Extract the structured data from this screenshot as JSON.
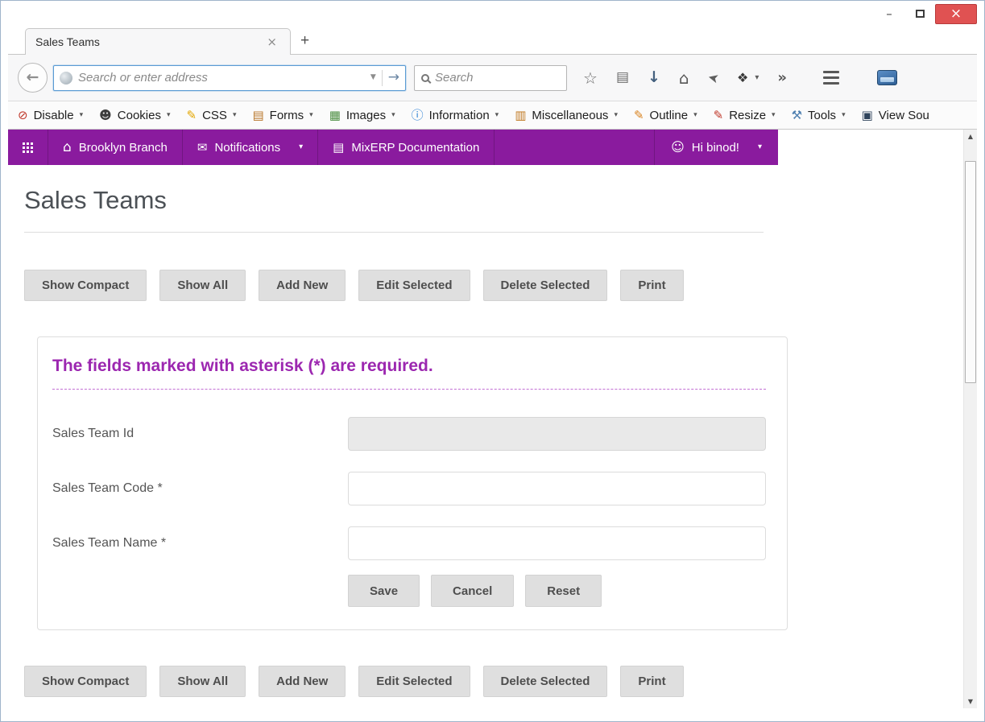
{
  "colors": {
    "brand_purple": "#8a1b9e",
    "note_purple": "#9c27b0",
    "close_red": "#e05252"
  },
  "glyphs": {
    "minimize": "–",
    "close": "×",
    "tab_close": "×",
    "new_tab": "+",
    "back": "←",
    "url_dropdown": "▼",
    "go": "→",
    "star": "☆",
    "clipboard": "▤",
    "download": "↓",
    "home": "⌂",
    "send": "➤",
    "addon": "❖",
    "caret": "▾",
    "overflow": "»",
    "house": "⌂",
    "envelope": "✉",
    "book": "▤",
    "smiley": "☺",
    "scroll_up": "▲",
    "scroll_down": "▼"
  },
  "browser": {
    "tab_title": "Sales Teams",
    "address_placeholder": "Search or enter address",
    "search_placeholder": "Search"
  },
  "devbar": {
    "items": [
      {
        "label": "Disable",
        "icon": "⊘",
        "icon_color": "#c0392b"
      },
      {
        "label": "Cookies",
        "icon": "☻",
        "icon_color": "#3d3d3d"
      },
      {
        "label": "CSS",
        "icon": "✎",
        "icon_color": "#e3a600"
      },
      {
        "label": "Forms",
        "icon": "▤",
        "icon_color": "#b8762a"
      },
      {
        "label": "Images",
        "icon": "▦",
        "icon_color": "#4e8f44"
      },
      {
        "label": "Information",
        "icon": "ⓘ",
        "icon_color": "#2a7fd4"
      },
      {
        "label": "Miscellaneous",
        "icon": "▥",
        "icon_color": "#c07820"
      },
      {
        "label": "Outline",
        "icon": "✎",
        "icon_color": "#d8821e"
      },
      {
        "label": "Resize",
        "icon": "✎",
        "icon_color": "#c0392b"
      },
      {
        "label": "Tools",
        "icon": "⚒",
        "icon_color": "#4e7fb0"
      },
      {
        "label": "View Sou",
        "icon": "▣",
        "icon_color": "#30445c"
      }
    ]
  },
  "navbar": {
    "branch": "Brooklyn Branch",
    "notifications": "Notifications",
    "documentation": "MixERP Documentation",
    "greeting": "Hi binod!"
  },
  "page": {
    "title": "Sales Teams",
    "actions": [
      "Show Compact",
      "Show All",
      "Add New",
      "Edit Selected",
      "Delete Selected",
      "Print"
    ],
    "form": {
      "required_note": "The fields marked with asterisk (*) are required.",
      "fields": [
        {
          "label": "Sales Team Id",
          "value": "",
          "disabled": true
        },
        {
          "label": "Sales Team Code *",
          "value": "",
          "disabled": false
        },
        {
          "label": "Sales Team Name *",
          "value": "",
          "disabled": false
        }
      ],
      "save": "Save",
      "cancel": "Cancel",
      "reset": "Reset"
    }
  }
}
